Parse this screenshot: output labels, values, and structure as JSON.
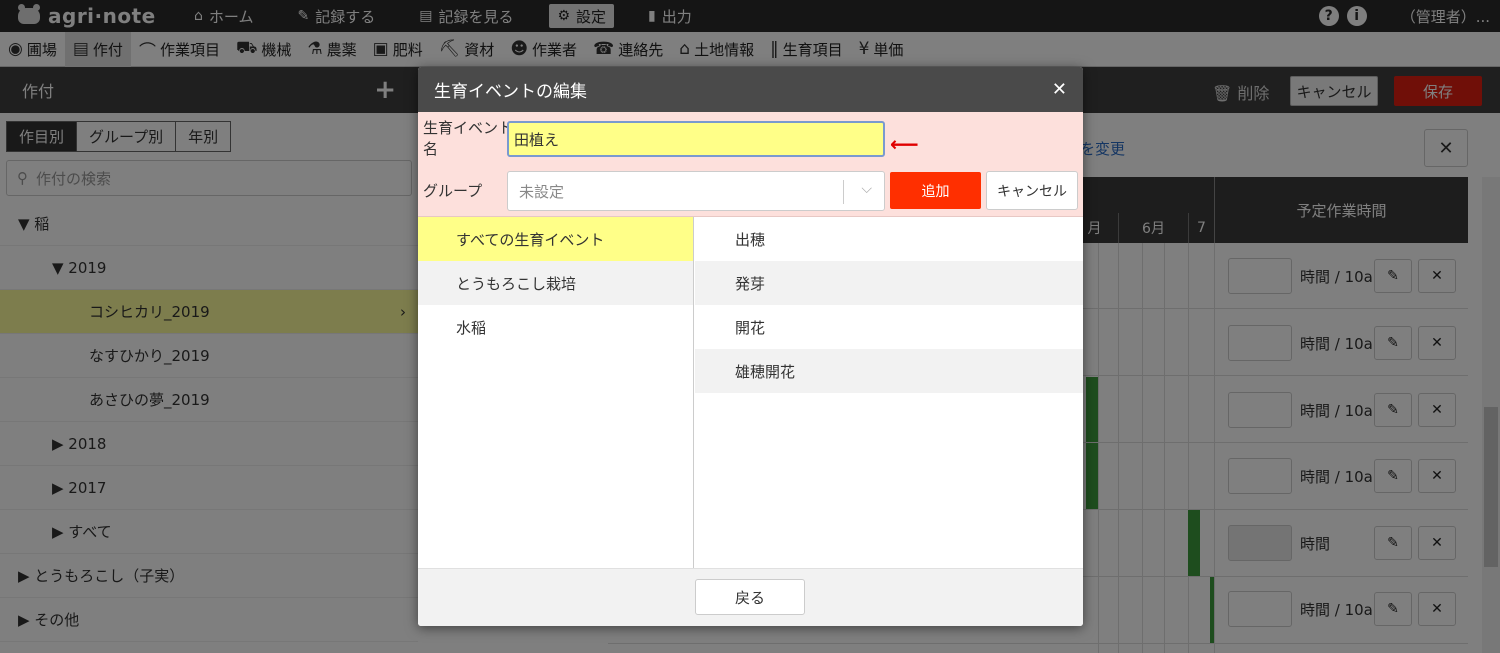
{
  "app": {
    "logo": "agri·note"
  },
  "topnav": [
    {
      "icon": "⌂",
      "label": "ホーム"
    },
    {
      "icon": "✎",
      "label": "記録する"
    },
    {
      "icon": "▤",
      "label": "記録を見る"
    },
    {
      "icon": "⚙",
      "label": "設定",
      "active": true
    },
    {
      "icon": "▮",
      "label": "出力"
    }
  ],
  "topright": {
    "help": "?",
    "info": "i",
    "user": "（管理者）..."
  },
  "subnav": [
    {
      "icon": "◉",
      "label": "圃場"
    },
    {
      "icon": "▤",
      "label": "作付",
      "active": true
    },
    {
      "icon": "⌒",
      "label": "作業項目"
    },
    {
      "icon": "⛟",
      "label": "機械"
    },
    {
      "icon": "⚗",
      "label": "農薬"
    },
    {
      "icon": "▣",
      "label": "肥料"
    },
    {
      "icon": "⛏",
      "label": "資材"
    },
    {
      "icon": "☻",
      "label": "作業者"
    },
    {
      "icon": "☎",
      "label": "連絡先"
    },
    {
      "icon": "⌂",
      "label": "土地情報"
    },
    {
      "icon": "‖",
      "label": "生育項目"
    },
    {
      "icon": "¥",
      "label": "単価"
    }
  ],
  "left": {
    "title": "作付",
    "segments": [
      "作目別",
      "グループ別",
      "年別"
    ],
    "search_placeholder": "作付の検索",
    "tree": [
      {
        "label": "▼ 稲",
        "level": 0
      },
      {
        "label": "▼ 2019",
        "level": 1
      },
      {
        "label": "コシヒカリ_2019",
        "level": 2,
        "selected": true
      },
      {
        "label": "なすひかり_2019",
        "level": 2
      },
      {
        "label": "あさひの夢_2019",
        "level": 2
      },
      {
        "label": "▶ 2018",
        "level": 1
      },
      {
        "label": "▶ 2017",
        "level": 1
      },
      {
        "label": "▶ すべて",
        "level": 1
      },
      {
        "label": "▶ とうもろこし（子実）",
        "level": 0
      },
      {
        "label": "▶ その他",
        "level": 0
      }
    ]
  },
  "right": {
    "delete": "削除",
    "cancel": "キャンセル",
    "save": "保存",
    "change_link": "を変更",
    "months": [
      "月",
      "6月",
      "7"
    ],
    "plan_title": "予定作業時間",
    "rows": [
      {
        "unit": "時間 / 10a"
      },
      {
        "unit": "時間 / 10a"
      },
      {
        "unit": "時間 / 10a"
      },
      {
        "unit": "時間 / 10a"
      },
      {
        "unit": "時間",
        "disabled": true
      },
      {
        "unit": "時間 / 10a"
      }
    ]
  },
  "modal": {
    "title": "生育イベントの編集",
    "name_label": "生育イベント名",
    "name_value": "田植え",
    "group_label": "グループ",
    "group_placeholder": "未設定",
    "add": "追加",
    "cancel": "キャンセル",
    "groups": [
      "すべての生育イベント",
      "とうもろこし栽培",
      "水稲"
    ],
    "events": [
      "出穂",
      "発芽",
      "開花",
      "雄穂開花"
    ],
    "back": "戻る"
  }
}
